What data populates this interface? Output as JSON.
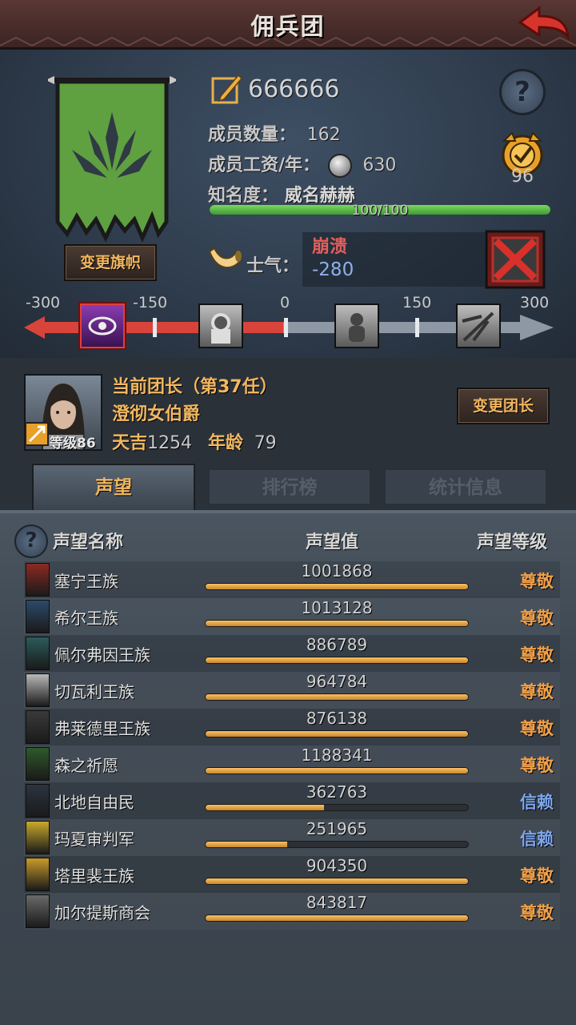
{
  "header": {
    "title": "佣兵团"
  },
  "company": {
    "gold": "666666",
    "members_label": "成员数量：",
    "members_value": "162",
    "wage_label": "成员工资/年：",
    "wage_value": "630",
    "fame_label": "知名度：",
    "fame_value": "威名赫赫",
    "fame_progress_text": "100/100",
    "fame_progress": 1.0,
    "badge_value": "96",
    "change_banner_label": "变更旗帜",
    "morale_label": "士气：",
    "morale_state": "崩溃",
    "morale_value": "-280",
    "morale_scale": [
      "-300",
      "-150",
      "0",
      "150",
      "300"
    ],
    "morale_fraction": 0.033
  },
  "captain": {
    "heading": "当前团长（第37任）",
    "name": "澄彻女伯爵",
    "level": "等级86",
    "luck_label": "天吉",
    "luck_value": "1254",
    "age_label": "年龄",
    "age_value": "79",
    "change_label": "变更团长"
  },
  "tabs": [
    {
      "label": "声望",
      "active": true
    },
    {
      "label": "排行榜",
      "active": false
    },
    {
      "label": "统计信息",
      "active": false
    }
  ],
  "list_headers": {
    "name": "声望名称",
    "value": "声望值",
    "level": "声望等级"
  },
  "colors": {
    "gold": "#f2b760",
    "respect": "#f0a04a",
    "trust": "#7ea8f0",
    "morale_red": "#e55f5a"
  },
  "factions": [
    {
      "name": "塞宁王族",
      "value": "1001868",
      "level": "尊敬",
      "fill": 1.0,
      "icon": "red-crest-icon",
      "color": "#8b2a22"
    },
    {
      "name": "希尔王族",
      "value": "1013128",
      "level": "尊敬",
      "fill": 1.0,
      "icon": "blue-arch-icon",
      "color": "#2c4a6a"
    },
    {
      "name": "佩尔弗因王族",
      "value": "886789",
      "level": "尊敬",
      "fill": 1.0,
      "icon": "teal-castle-icon",
      "color": "#2a5c5a"
    },
    {
      "name": "切瓦利王族",
      "value": "964784",
      "level": "尊敬",
      "fill": 1.0,
      "icon": "scales-icon",
      "color": "#b8b8b8"
    },
    {
      "name": "弗莱德里王族",
      "value": "876138",
      "level": "尊敬",
      "fill": 1.0,
      "icon": "stag-icon",
      "color": "#3a3a3a"
    },
    {
      "name": "森之祈愿",
      "value": "1188341",
      "level": "尊敬",
      "fill": 1.0,
      "icon": "tree-icon",
      "color": "#2e5a2a"
    },
    {
      "name": "北地自由民",
      "value": "362763",
      "level": "信赖",
      "fill": 0.45,
      "icon": "axe-icon",
      "color": "#2b3440"
    },
    {
      "name": "玛夏审判军",
      "value": "251965",
      "level": "信赖",
      "fill": 0.31,
      "icon": "chevron-icon",
      "color": "#c9a92a"
    },
    {
      "name": "塔里裴王族",
      "value": "904350",
      "level": "尊敬",
      "fill": 1.0,
      "icon": "crown-icon",
      "color": "#c99a2a"
    },
    {
      "name": "加尔提斯商会",
      "value": "843817",
      "level": "尊敬",
      "fill": 1.0,
      "icon": "chest-icon",
      "color": "#6a6a6a"
    }
  ]
}
